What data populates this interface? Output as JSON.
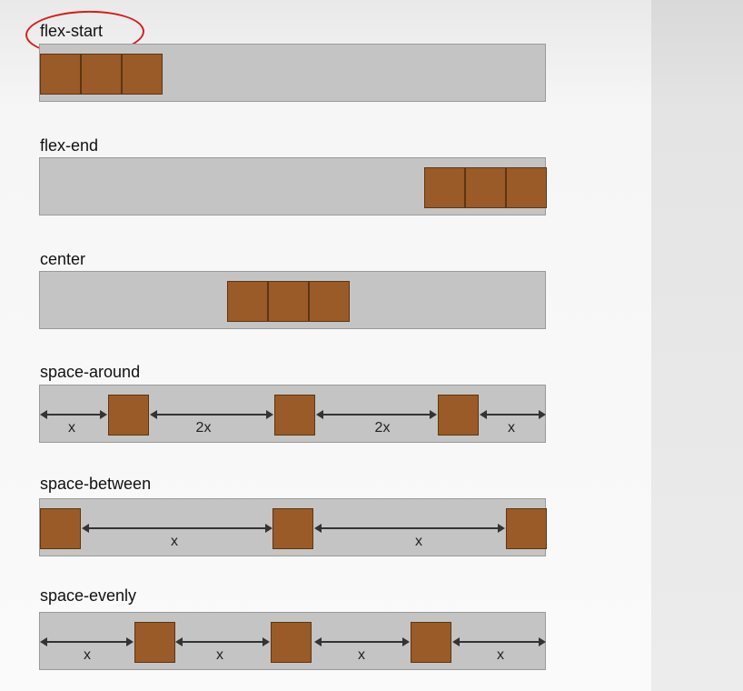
{
  "diagram": {
    "sections": [
      {
        "label": "flex-start",
        "highlighted": true
      },
      {
        "label": "flex-end"
      },
      {
        "label": "center"
      },
      {
        "label": "space-around",
        "gap_labels": [
          "x",
          "2x",
          "2x",
          "x"
        ]
      },
      {
        "label": "space-between",
        "gap_labels": [
          "x",
          "x"
        ]
      },
      {
        "label": "space-evenly",
        "gap_labels": [
          "x",
          "x",
          "x",
          "x"
        ]
      }
    ],
    "colors": {
      "container": "#c4c4c4",
      "item": "#9a5b28",
      "highlight": "#d31d1d",
      "arrow": "#333333"
    }
  }
}
